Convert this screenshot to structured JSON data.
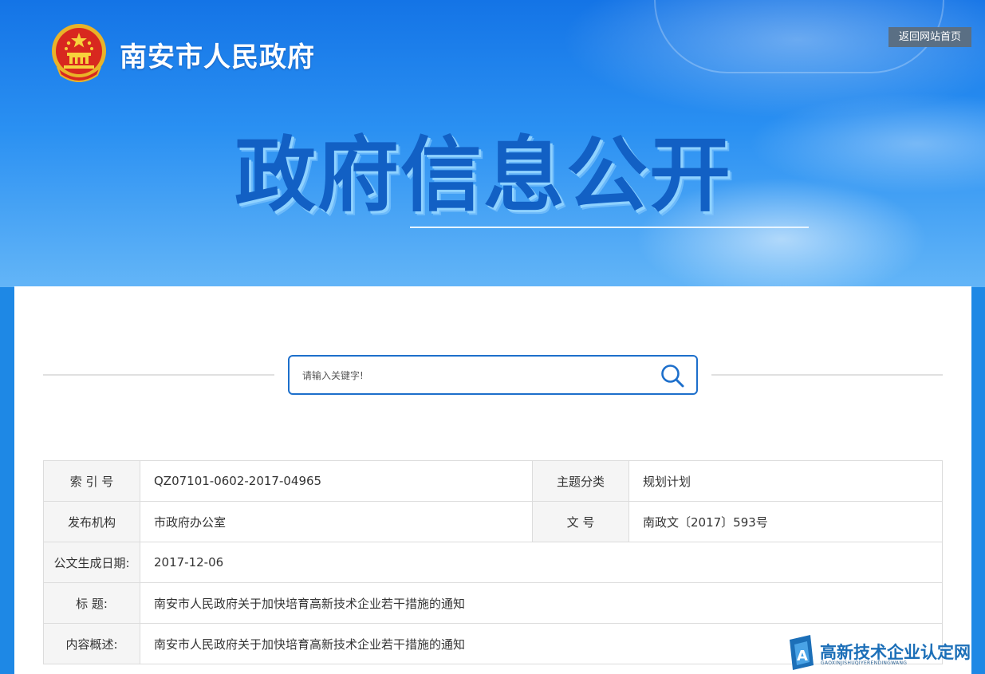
{
  "header": {
    "site_title": "南安市人民政府",
    "home_link": "返回网站首页",
    "hero_title": "政府信息公开"
  },
  "search": {
    "placeholder": "请输入关键字!"
  },
  "meta": {
    "rows": [
      {
        "label": "索 引 号",
        "value": "QZ07101-0602-2017-04965",
        "label2": "主题分类",
        "value2": "规划计划"
      },
      {
        "label": "发布机构",
        "value": "市政府办公室",
        "label2": "文 号",
        "value2": "南政文〔2017〕593号"
      },
      {
        "label": "公文生成日期:",
        "value": "2017-12-06"
      },
      {
        "label": "标 题:",
        "value": "南安市人民政府关于加快培育高新技术企业若干措施的通知"
      },
      {
        "label": "内容概述:",
        "value": "南安市人民政府关于加快培育高新技术企业若干措施的通知"
      }
    ]
  },
  "watermark": {
    "text": "高新技术企业认定网",
    "subtext": "GAOXINJISHUQIYERENDINGWANG"
  },
  "colors": {
    "banner_blue": "#1474e6",
    "hero_text": "#1260c4",
    "search_border": "#1d6fcb",
    "home_button": "#5a6f84"
  }
}
